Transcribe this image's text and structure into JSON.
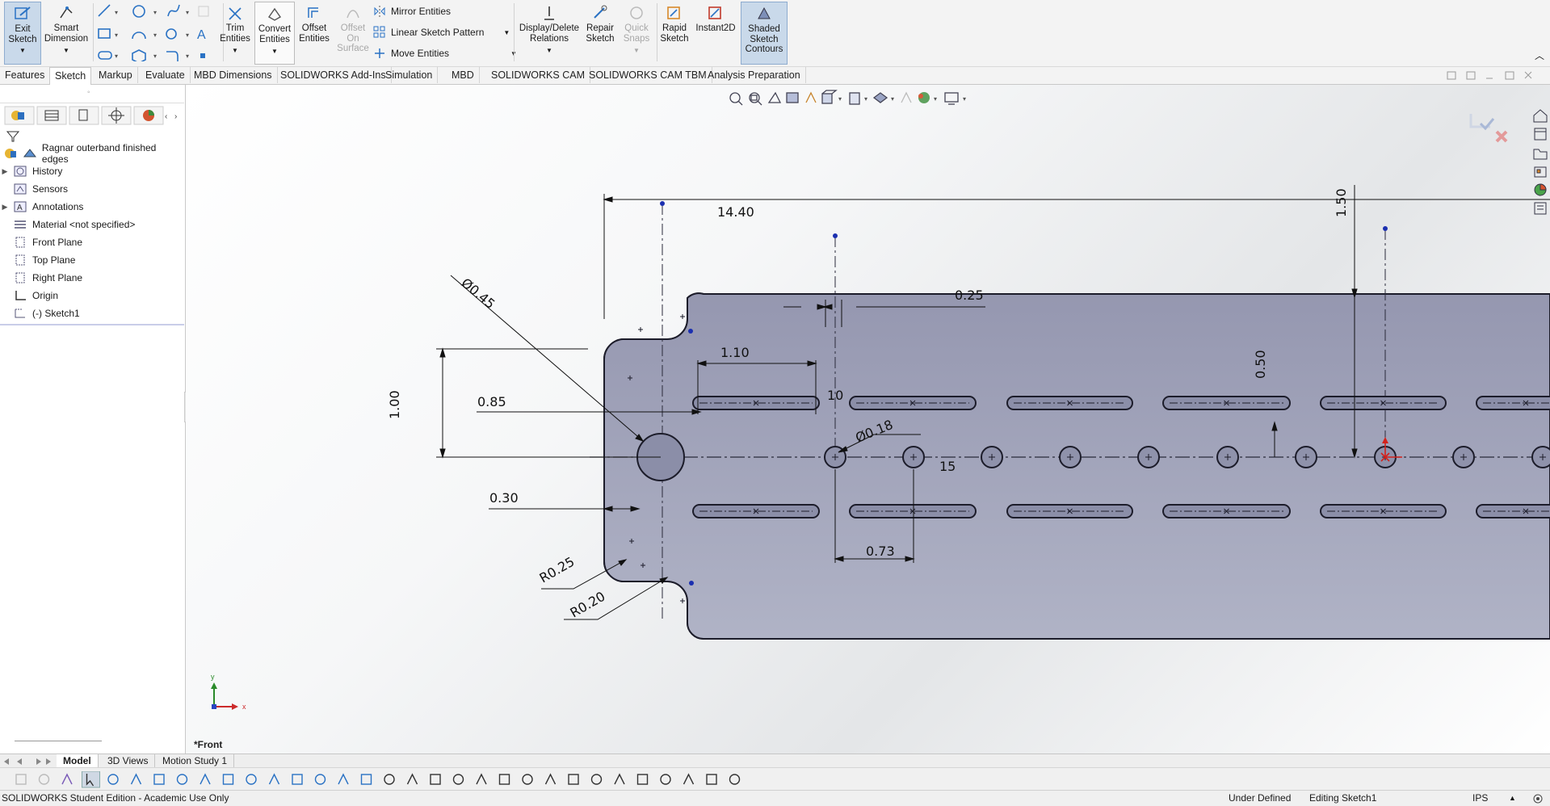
{
  "ribbon": {
    "exit_sketch": [
      "Exit",
      "Sketch"
    ],
    "smart_dimension": [
      "Smart",
      "Dimension"
    ],
    "trim_entities": [
      "Trim",
      "Entities"
    ],
    "convert_entities": [
      "Convert",
      "Entities"
    ],
    "offset_entities": [
      "Offset",
      "Entities"
    ],
    "offset_on_surface": [
      "Offset",
      "On",
      "Surface"
    ],
    "mirror_entities": "Mirror Entities",
    "linear_sketch_pattern": "Linear Sketch Pattern",
    "move_entities": "Move Entities",
    "display_delete_relations": [
      "Display/Delete",
      "Relations"
    ],
    "repair_sketch": [
      "Repair",
      "Sketch"
    ],
    "quick_snaps": [
      "Quick",
      "Snaps"
    ],
    "rapid_sketch": [
      "Rapid",
      "Sketch"
    ],
    "instant2d": "Instant2D",
    "shaded_sketch_contours": [
      "Shaded",
      "Sketch",
      "Contours"
    ]
  },
  "command_tabs": [
    "Features",
    "Sketch",
    "Markup",
    "Evaluate",
    "MBD Dimensions",
    "SOLIDWORKS Add-Ins",
    "Simulation",
    "MBD",
    "SOLIDWORKS CAM",
    "SOLIDWORKS CAM TBM",
    "Analysis Preparation"
  ],
  "active_command_tab": "Sketch",
  "feature_tree": {
    "root": "Ragnar outerband finished edges",
    "items": [
      "History",
      "Sensors",
      "Annotations",
      "Material <not specified>",
      "Front Plane",
      "Top Plane",
      "Right Plane",
      "Origin",
      "(-) Sketch1"
    ]
  },
  "viewport": {
    "view_label": "*Front",
    "dimensions": {
      "d1440": "14.40",
      "d045": "Ø0.45",
      "d025": "0.25",
      "d110": "1.10",
      "d10": "10",
      "d050": "0.50",
      "d150": "1.50",
      "d100": "1.00",
      "d085": "0.85",
      "d018": "Ø0.18",
      "d15": "15",
      "d030": "0.30",
      "d073": "0.73",
      "r025": "R0.25",
      "r020": "R0.20"
    },
    "triad": {
      "x": "x",
      "y": "y"
    }
  },
  "bottom_tabs": [
    "Model",
    "3D Views",
    "Motion Study 1"
  ],
  "active_bottom_tab": "Model",
  "status": {
    "left": "SOLIDWORKS Student Edition - Academic Use Only",
    "state": "Under Defined",
    "editing": "Editing Sketch1",
    "units": "IPS"
  },
  "colors": {
    "part_fill": "#a3a6bd",
    "accent": "#1f6fc5",
    "sketch_line": "#1c1c2a"
  }
}
